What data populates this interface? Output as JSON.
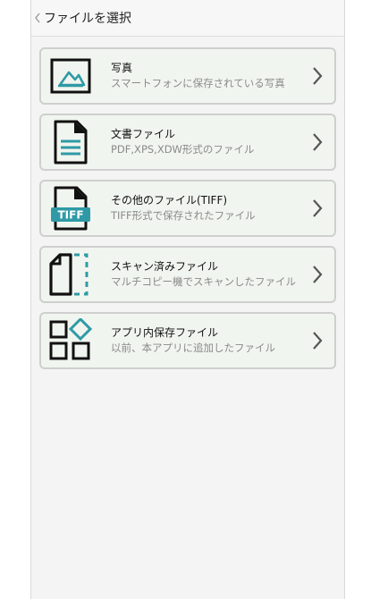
{
  "header": {
    "title": "ファイルを選択"
  },
  "items": [
    {
      "title": "写真",
      "desc": "スマートフォンに保存されている写真",
      "icon": "photo-icon"
    },
    {
      "title": "文書ファイル",
      "desc": "PDF,XPS,XDW形式のファイル",
      "icon": "document-icon"
    },
    {
      "title": "その他のファイル(TIFF)",
      "desc": "TIFF形式で保存されたファイル",
      "icon": "tiff-file-icon",
      "badge": "TIFF"
    },
    {
      "title": "スキャン済みファイル",
      "desc": "マルチコピー機でスキャンしたファイル",
      "icon": "scan-file-icon"
    },
    {
      "title": "アプリ内保存ファイル",
      "desc": "以前、本アプリに追加したファイル",
      "icon": "app-storage-icon"
    }
  ],
  "colors": {
    "accent": "#2f9aa6",
    "card_bg": "#f1f5ef",
    "border": "#cfcfcf"
  }
}
